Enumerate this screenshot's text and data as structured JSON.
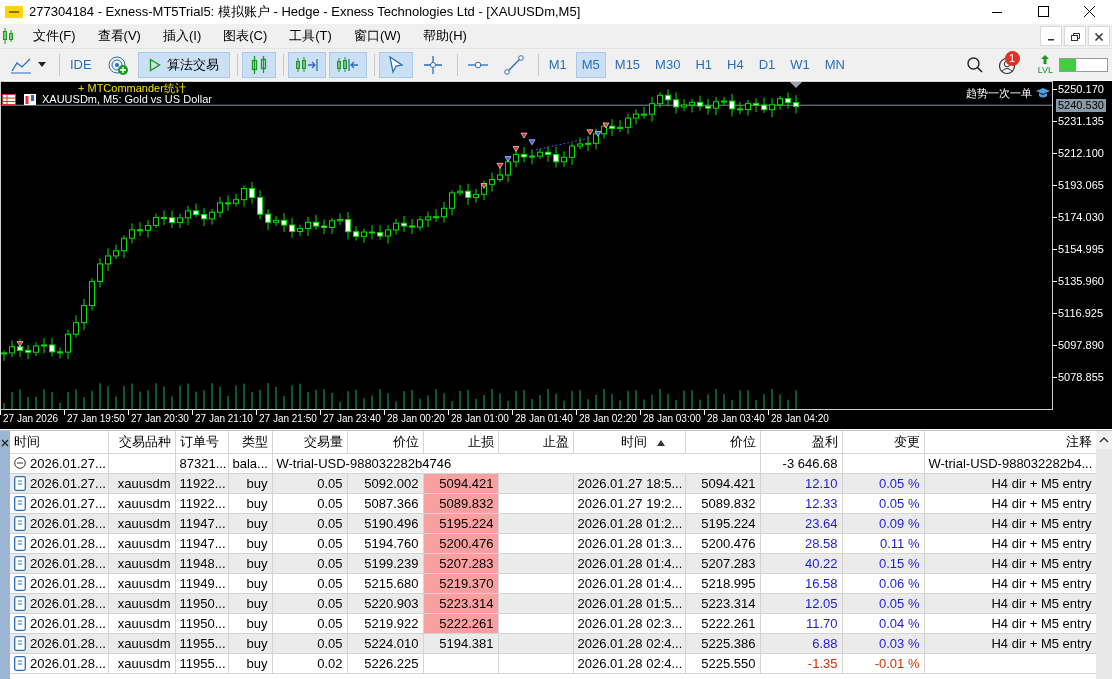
{
  "window": {
    "title": "277304184 - Exness-MT5Trial5: 模拟账户 - Hedge - Exness Technologies Ltd - [XAUUSDm,M5]"
  },
  "menu": [
    "文件(F)",
    "查看(V)",
    "插入(I)",
    "图表(C)",
    "工具(T)",
    "窗口(W)",
    "帮助(H)"
  ],
  "toolbar": {
    "buttons": [
      {
        "kind": "chart_type",
        "selected": false
      },
      {
        "kind": "ide",
        "label": "IDE",
        "selected": false
      },
      {
        "kind": "robot",
        "selected": false
      },
      {
        "kind": "algo",
        "label": "算法交易",
        "selected": true
      },
      {
        "kind": "candles",
        "selected": true
      },
      {
        "kind": "autoscroll",
        "selected": true
      },
      {
        "kind": "shift",
        "selected": true
      },
      {
        "kind": "cursor",
        "selected": true
      },
      {
        "kind": "crosshair",
        "selected": false
      },
      {
        "kind": "hline",
        "selected": false
      },
      {
        "kind": "trendline",
        "selected": false
      }
    ],
    "timeframes": [
      {
        "label": "M1",
        "selected": false
      },
      {
        "label": "M5",
        "selected": true
      },
      {
        "label": "M15",
        "selected": false
      },
      {
        "label": "M30",
        "selected": false
      },
      {
        "label": "H1",
        "selected": false
      },
      {
        "label": "H4",
        "selected": false
      },
      {
        "label": "D1",
        "selected": false
      },
      {
        "label": "W1",
        "selected": false
      },
      {
        "label": "MN",
        "selected": false
      }
    ],
    "notification_badge": "1",
    "lvl_label": "LVL",
    "progress": {
      "level": 0.35
    }
  },
  "chart": {
    "header": "XAUUSDm, M5:  Gold vs US Dollar",
    "overlay_label": "+ MTCommander统计",
    "indicator_label": "趋势一次一单",
    "current_price": "5240.530",
    "price_labels": [
      "5250.170",
      "5231.135",
      "5212.100",
      "5193.065",
      "5174.030",
      "5154.995",
      "5135.960",
      "5116.925",
      "5097.890",
      "5078.855"
    ],
    "time_labels": [
      "27 Jan 2026",
      "27 Jan 19:50",
      "27 Jan 20:30",
      "27 Jan 21:10",
      "27 Jan 21:50",
      "27 Jan 23:40",
      "28 Jan 00:20",
      "28 Jan 01:00",
      "28 Jan 01:40",
      "28 Jan 02:20",
      "28 Jan 03:00",
      "28 Jan 03:40",
      "28 Jan 04:20"
    ]
  },
  "table": {
    "columns": [
      {
        "label": "时间",
        "sorted": false
      },
      {
        "label": "交易品种",
        "sorted": false
      },
      {
        "label": "订单号",
        "sorted": false
      },
      {
        "label": "类型",
        "sorted": false
      },
      {
        "label": "交易量",
        "sorted": false
      },
      {
        "label": "价位",
        "sorted": false
      },
      {
        "label": "止损",
        "sorted": false
      },
      {
        "label": "止盈",
        "sorted": false
      },
      {
        "label": "时间",
        "sorted": true
      },
      {
        "label": "价位",
        "sorted": false
      },
      {
        "label": "盈利",
        "sorted": false
      },
      {
        "label": "变更",
        "sorted": false
      },
      {
        "label": "注释",
        "sorted": false
      }
    ],
    "rows": [
      {
        "kind": "balance",
        "expanded": true,
        "time": "2026.01.27...",
        "order": "87321...",
        "type": "bala...",
        "description": "W-trial-USD-988032282b4746",
        "profit": "-3 646.68",
        "comment": "W-trial-USD-988032282b4..."
      },
      {
        "kind": "deal",
        "time": "2026.01.27...",
        "symbol": "xauusdm",
        "order": "11922...",
        "type": "buy",
        "volume": "0.05",
        "price": "5092.002",
        "sl": "5094.421",
        "sl_hit": true,
        "close_time": "2026.01.27 18:5...",
        "close_price": "5094.421",
        "profit": "12.10",
        "change": "0.05 %",
        "color": "#1a1ae0",
        "comment": "H4 dir + M5 entry"
      },
      {
        "kind": "deal",
        "time": "2026.01.27...",
        "symbol": "xauusdm",
        "order": "11922...",
        "type": "buy",
        "volume": "0.05",
        "price": "5087.366",
        "sl": "5089.832",
        "sl_hit": true,
        "close_time": "2026.01.27 19:2...",
        "close_price": "5089.832",
        "profit": "12.33",
        "change": "0.05 %",
        "color": "#1a1ae0",
        "comment": "H4 dir + M5 entry"
      },
      {
        "kind": "deal",
        "time": "2026.01.28...",
        "symbol": "xauusdm",
        "order": "11947...",
        "type": "buy",
        "volume": "0.05",
        "price": "5190.496",
        "sl": "5195.224",
        "sl_hit": true,
        "close_time": "2026.01.28 01:2...",
        "close_price": "5195.224",
        "profit": "23.64",
        "change": "0.09 %",
        "color": "#1a1ae0",
        "comment": "H4 dir + M5 entry"
      },
      {
        "kind": "deal",
        "time": "2026.01.28...",
        "symbol": "xauusdm",
        "order": "11947...",
        "type": "buy",
        "volume": "0.05",
        "price": "5194.760",
        "sl": "5200.476",
        "sl_hit": true,
        "close_time": "2026.01.28 01:3...",
        "close_price": "5200.476",
        "profit": "28.58",
        "change": "0.11 %",
        "color": "#1a1ae0",
        "comment": "H4 dir + M5 entry"
      },
      {
        "kind": "deal",
        "time": "2026.01.28...",
        "symbol": "xauusdm",
        "order": "11948...",
        "type": "buy",
        "volume": "0.05",
        "price": "5199.239",
        "sl": "5207.283",
        "sl_hit": true,
        "close_time": "2026.01.28 01:4...",
        "close_price": "5207.283",
        "profit": "40.22",
        "change": "0.15 %",
        "color": "#1a1ae0",
        "comment": "H4 dir + M5 entry"
      },
      {
        "kind": "deal",
        "time": "2026.01.28...",
        "symbol": "xauusdm",
        "order": "11949...",
        "type": "buy",
        "volume": "0.05",
        "price": "5215.680",
        "sl": "5219.370",
        "sl_hit": true,
        "close_time": "2026.01.28 01:4...",
        "close_price": "5218.995",
        "profit": "16.58",
        "change": "0.06 %",
        "color": "#1a1ae0",
        "comment": "H4 dir + M5 entry"
      },
      {
        "kind": "deal",
        "time": "2026.01.28...",
        "symbol": "xauusdm",
        "order": "11950...",
        "type": "buy",
        "volume": "0.05",
        "price": "5220.903",
        "sl": "5223.314",
        "sl_hit": true,
        "close_time": "2026.01.28 01:5...",
        "close_price": "5223.314",
        "profit": "12.05",
        "change": "0.05 %",
        "color": "#1a1ae0",
        "comment": "H4 dir + M5 entry"
      },
      {
        "kind": "deal",
        "time": "2026.01.28...",
        "symbol": "xauusdm",
        "order": "11950...",
        "type": "buy",
        "volume": "0.05",
        "price": "5219.922",
        "sl": "5222.261",
        "sl_hit": true,
        "close_time": "2026.01.28 02:3...",
        "close_price": "5222.261",
        "profit": "11.70",
        "change": "0.04 %",
        "color": "#1a1ae0",
        "comment": "H4 dir + M5 entry"
      },
      {
        "kind": "deal",
        "time": "2026.01.28...",
        "symbol": "xauusdm",
        "order": "11955...",
        "type": "buy",
        "volume": "0.05",
        "price": "5224.010",
        "sl": "5194.381",
        "sl_hit": false,
        "close_time": "2026.01.28 02:4...",
        "close_price": "5225.386",
        "profit": "6.88",
        "change": "0.03 %",
        "color": "#1a1ae0",
        "comment": "H4 dir + M5 entry"
      },
      {
        "kind": "deal",
        "time": "2026.01.28...",
        "symbol": "xauusdm",
        "order": "11955...",
        "type": "buy",
        "volume": "0.02",
        "price": "5226.225",
        "sl_hit": false,
        "close_time": "2026.01.28 02:4...",
        "close_price": "5225.550",
        "profit": "-1.35",
        "change": "-0.01 %",
        "color": "#d03000"
      }
    ]
  }
}
